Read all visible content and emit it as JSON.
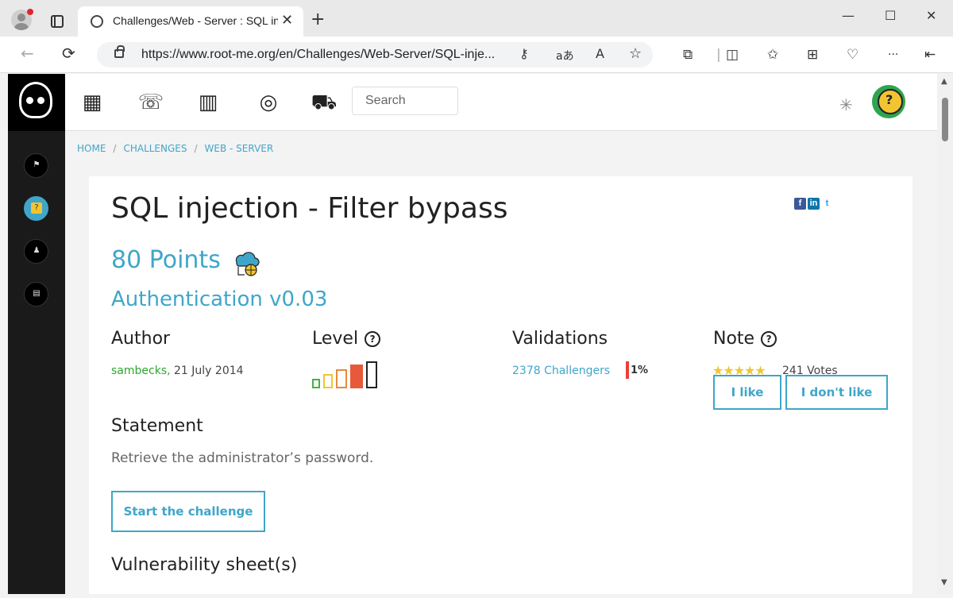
{
  "browser": {
    "tab_title": "Challenges/Web - Server : SQL injection",
    "tab_close": "✕",
    "new_tab": "+",
    "minimize": "—",
    "maximize": "☐",
    "close": "✕",
    "url": "https://www.root-me.org/en/Challenges/Web-Server/SQL-inje...",
    "icons": [
      "back-icon",
      "refresh-icon",
      "lock-icon",
      "key-icon",
      "translate-icon",
      "read-aloud-icon",
      "favorite-icon",
      "extensions-icon",
      "split-screen-icon",
      "favorites-icon",
      "collections-icon",
      "health-icon",
      "more-icon",
      "sidebar-icon"
    ],
    "read_aloud_label": "A",
    "translate_label": "aあ",
    "more_label": "···"
  },
  "search": {
    "placeholder": "Search"
  },
  "breadcrumb": [
    "HOME",
    "CHALLENGES",
    "WEB - SERVER"
  ],
  "challenge": {
    "title": "SQL injection - Filter bypass",
    "points": "80 Points",
    "subtitle": "Authentication v0.03",
    "author_label": "Author",
    "author_name": "sambecks,",
    "author_date": "21 July 2014",
    "level_label": "Level",
    "level_value": 4,
    "level_max": 5,
    "validations_label": "Validations",
    "validations_value": "2378 Challengers",
    "validations_pct": "1%",
    "note_label": "Note",
    "stars": "★★★★★",
    "votes": "241 Votes",
    "like_label": "I like",
    "dislike_label": "I don't like",
    "statement_label": "Statement",
    "statement_text": "Retrieve the administrator’s password.",
    "start_label": "Start the challenge",
    "vuln_label": "Vulnerability sheet(s)"
  },
  "social": [
    "f",
    "in",
    "t"
  ],
  "colors": {
    "accent": "#3fa6c9",
    "author": "#2ea42f",
    "level_active": "#e8583b",
    "level_low": "#41b53b",
    "level_mid": "#f2c432"
  }
}
